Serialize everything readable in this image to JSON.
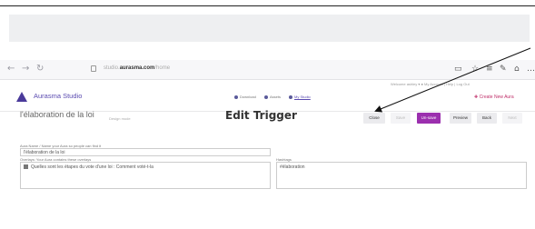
{
  "browser": {
    "url_host": "studio.",
    "url_domain": "aurasma.com",
    "url_path": "/home"
  },
  "header": {
    "welcome_text": "Welcome ashley  ▾  ●  My Account  |  Help  |  Log Out",
    "brand": "Aurasma Studio",
    "nav_download": "Download",
    "nav_assets": "Assets",
    "nav_mystudio": "My Studio",
    "create_new": "✚ Create New Aura"
  },
  "page": {
    "title": "l'élaboration de la loi",
    "subtitle": "Design mode",
    "edit_trigger": "Edit Trigger"
  },
  "toolbar": {
    "close": "Close",
    "save": "Save",
    "unsave": "Un-save",
    "preview": "Preview",
    "back": "Back",
    "next": "Next"
  },
  "form": {
    "trigger_name_label": "Aura Name / Name your Aura so people can find it",
    "trigger_name_value": "l'élaboration de la loi",
    "overlays_label": "Overlays: Your Aura contains these overlays",
    "overlay_item": "Quelles sont les étapes du vote d'une loi : Comment voté-t-la",
    "hashtags_label": "Hashtags",
    "hashtags_value": "#élaboration"
  },
  "colors": {
    "brand": "#5a4ab0",
    "primary_button": "#9b2fae",
    "create_new": "#c0306a"
  }
}
